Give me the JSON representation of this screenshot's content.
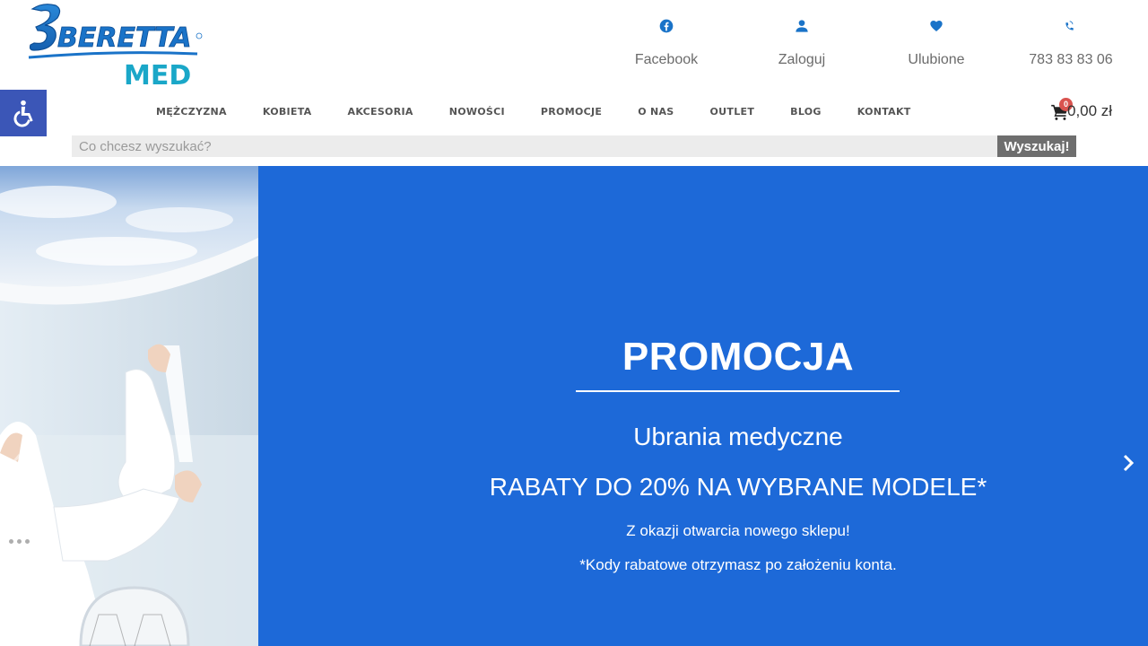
{
  "brand": {
    "logo_text_main": "BERETTA",
    "logo_text_sub": "MED",
    "colors": {
      "logo_blue": "#1a73c8",
      "logo_teal": "#1aa7c8"
    }
  },
  "top_links": [
    {
      "label": "Facebook",
      "icon": "facebook-icon"
    },
    {
      "label": "Zaloguj",
      "icon": "user-icon"
    },
    {
      "label": "Ulubione",
      "icon": "heart-icon"
    },
    {
      "label": "783 83 83 06",
      "icon": "phone-icon"
    }
  ],
  "nav": {
    "items": [
      "MĘŻCZYZNA",
      "KOBIETA",
      "AKCESORIA",
      "NOWOŚCI",
      "PROMOCJE",
      "O NAS",
      "OUTLET",
      "BLOG",
      "KONTAKT"
    ]
  },
  "cart": {
    "count": "0",
    "amount": "0,00 zł",
    "icon": "cart-icon"
  },
  "search": {
    "placeholder": "Co chcesz wyszukać?",
    "button_label": "Wyszukaj!"
  },
  "hero": {
    "title": "PROMOCJA",
    "subtitle": "Ubrania medyczne",
    "discount": "RABATY DO 20% NA WYBRANE MODELE*",
    "note1": "Z okazji otwarcia nowego sklepu!",
    "note2": "*Kody rabatowe otrzymasz po założeniu konta.",
    "background_color": "#1d69d8"
  },
  "accessibility": {
    "icon": "wheelchair-icon",
    "color": "#3b56b7"
  }
}
